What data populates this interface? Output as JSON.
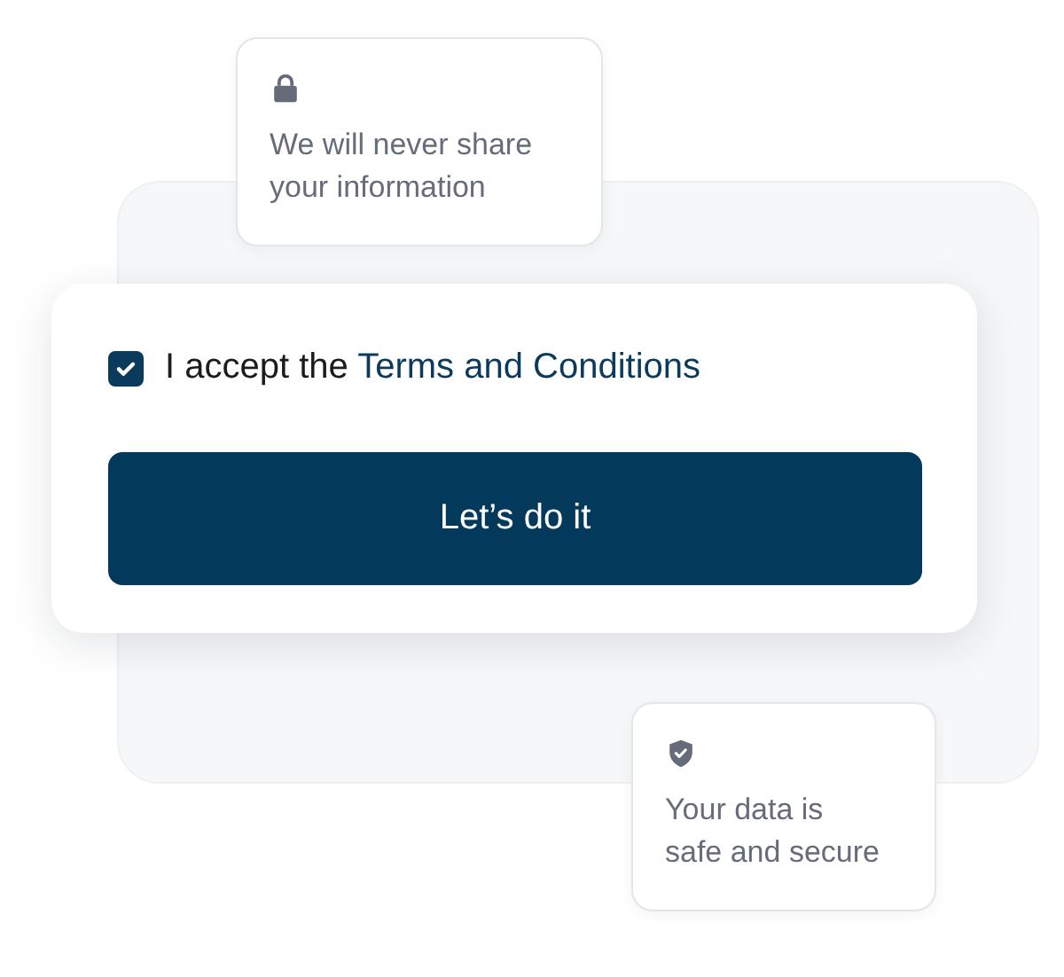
{
  "notes": [
    {
      "kind": "lock",
      "text": "We will never share your information"
    },
    {
      "kind": "shield",
      "text": "Your data is safe and secure"
    }
  ],
  "consent": {
    "checked": true,
    "label": "I accept the",
    "link": "Terms and Conditions"
  },
  "button": {
    "label": "Let’s do it"
  }
}
